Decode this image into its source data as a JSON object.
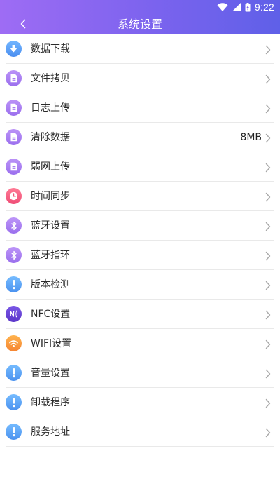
{
  "status_bar": {
    "time": "9:22",
    "icons": [
      "wifi-icon",
      "cellular-signal-icon",
      "battery-icon"
    ]
  },
  "header": {
    "title": "系统设置",
    "back_icon": "chevron-left-icon",
    "gradient": [
      "#9e6cf4",
      "#5f60e8"
    ]
  },
  "settings": {
    "items": [
      {
        "label": "数据下载",
        "value": "",
        "icon": "download-icon",
        "icon_color": "#5aa3f5"
      },
      {
        "label": "文件拷贝",
        "value": "",
        "icon": "document-icon",
        "icon_color": "#a67cf0"
      },
      {
        "label": "日志上传",
        "value": "",
        "icon": "document-icon",
        "icon_color": "#a67cf0"
      },
      {
        "label": "清除数据",
        "value": "8MB",
        "icon": "document-icon",
        "icon_color": "#a67cf0"
      },
      {
        "label": "弱网上传",
        "value": "",
        "icon": "document-icon",
        "icon_color": "#a67cf0"
      },
      {
        "label": "时间同步",
        "value": "",
        "icon": "clock-icon",
        "icon_color": "#f0557a"
      },
      {
        "label": "蓝牙设置",
        "value": "",
        "icon": "bluetooth-icon",
        "icon_color": "#a87df2"
      },
      {
        "label": "蓝牙指环",
        "value": "",
        "icon": "bluetooth-icon",
        "icon_color": "#a87df2"
      },
      {
        "label": "版本检测",
        "value": "",
        "icon": "alert-icon",
        "icon_color": "#5aa8f5"
      },
      {
        "label": "NFC设置",
        "value": "",
        "icon": "nfc-icon",
        "icon_color": "#6a47d8"
      },
      {
        "label": "WIFI设置",
        "value": "",
        "icon": "wifi-icon",
        "icon_color": "#f79a3a"
      },
      {
        "label": "音量设置",
        "value": "",
        "icon": "alert-icon",
        "icon_color": "#5aa8f5"
      },
      {
        "label": "卸载程序",
        "value": "",
        "icon": "alert-icon",
        "icon_color": "#5aa8f5"
      },
      {
        "label": "服务地址",
        "value": "",
        "icon": "alert-icon",
        "icon_color": "#5aa8f5"
      }
    ]
  }
}
